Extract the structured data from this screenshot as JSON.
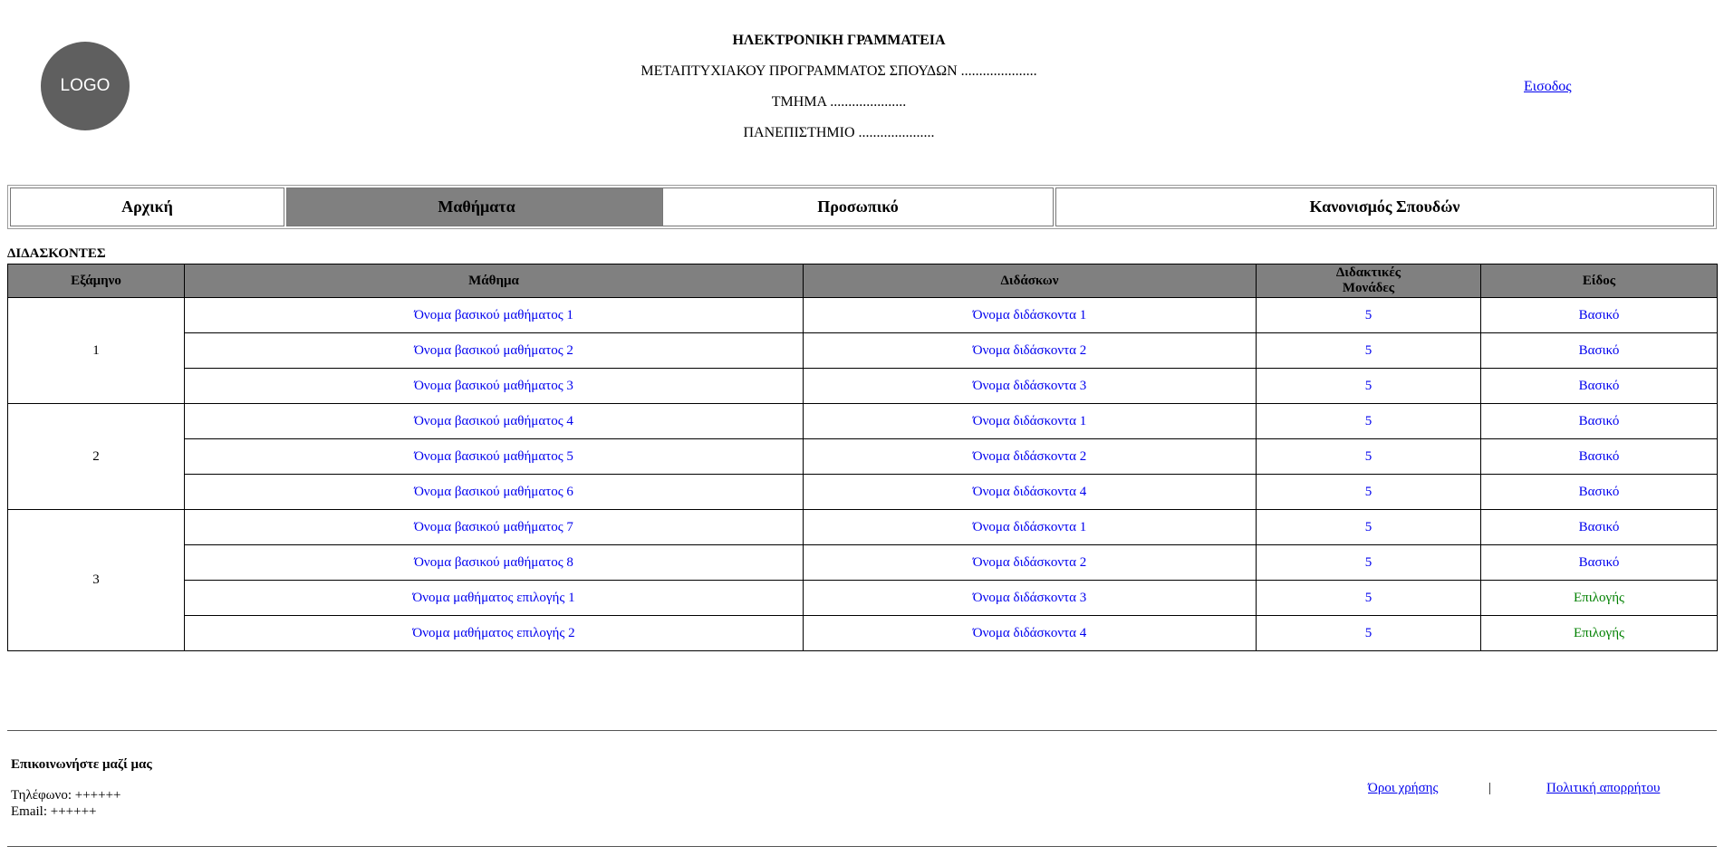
{
  "header": {
    "logo_text": "LOGO",
    "title": "ΗΛΕΚΤΡΟΝΙΚΗ ΓΡΑΜΜΑΤΕΙΑ",
    "program": "ΜΕΤΑΠΤΥΧΙΑΚΟΥ ΠΡΟΓΡΑΜΜΑΤΟΣ ΣΠΟΥΔΩΝ .....................",
    "department": "ΤΜΗΜΑ .....................",
    "university": "ΠΑΝΕΠΙΣΤΗΜΙΟ .....................",
    "login": "Εισοδος"
  },
  "nav": {
    "tabs": [
      {
        "label": "Αρχική",
        "active": false
      },
      {
        "label": "Μαθήματα",
        "active": true
      },
      {
        "label": "Προσωπικό",
        "active": false
      },
      {
        "label": "Κανονισμός Σπουδών",
        "active": false
      }
    ]
  },
  "section_title": "ΔΙΔΑΣΚΟΝΤΕΣ",
  "table": {
    "headers": [
      "Εξάμηνο",
      "Μάθημα",
      "Διδάσκων",
      "Διδακτικές Μονάδες",
      "Είδος"
    ],
    "semesters": [
      {
        "label": "1",
        "rows": [
          {
            "course": "Όνομα βασικού μαθήματος 1",
            "teacher": "Όνομα διδάσκοντα 1",
            "units": "5",
            "type": "Βασικό",
            "elective": false
          },
          {
            "course": "Όνομα βασικού μαθήματος 2",
            "teacher": "Όνομα διδάσκοντα 2",
            "units": "5",
            "type": "Βασικό",
            "elective": false
          },
          {
            "course": "Όνομα βασικού μαθήματος 3",
            "teacher": "Όνομα διδάσκοντα 3",
            "units": "5",
            "type": "Βασικό",
            "elective": false
          }
        ]
      },
      {
        "label": "2",
        "rows": [
          {
            "course": "Όνομα βασικού μαθήματος 4",
            "teacher": "Όνομα διδάσκοντα 1",
            "units": "5",
            "type": "Βασικό",
            "elective": false
          },
          {
            "course": "Όνομα βασικού μαθήματος 5",
            "teacher": "Όνομα διδάσκοντα 2",
            "units": "5",
            "type": "Βασικό",
            "elective": false
          },
          {
            "course": "Όνομα βασικού μαθήματος 6",
            "teacher": "Όνομα διδάσκοντα 4",
            "units": "5",
            "type": "Βασικό",
            "elective": false
          }
        ]
      },
      {
        "label": "3",
        "rows": [
          {
            "course": "Όνομα βασικού μαθήματος 7",
            "teacher": "Όνομα διδάσκοντα 1",
            "units": "5",
            "type": "Βασικό",
            "elective": false
          },
          {
            "course": "Όνομα βασικού μαθήματος 8",
            "teacher": "Όνομα διδάσκοντα 2",
            "units": "5",
            "type": "Βασικό",
            "elective": false
          },
          {
            "course": "Όνομα μαθήματος επιλογής 1",
            "teacher": "Όνομα διδάσκοντα 3",
            "units": "5",
            "type": "Επιλογής",
            "elective": true
          },
          {
            "course": "Όνομα μαθήματος επιλογής 2",
            "teacher": "Όνομα διδάσκοντα 4",
            "units": "5",
            "type": "Επιλογής",
            "elective": true
          }
        ]
      }
    ]
  },
  "footer": {
    "contact_title": "Επικοινωνήστε μαζί μας",
    "phone": "Τηλέφωνο: ++++++",
    "email": "Email: ++++++",
    "terms": "Όροι χρήσης",
    "separator": "|",
    "privacy": "Πολιτική απορρήτου"
  },
  "colors": {
    "link": "#0000ee",
    "elective": "#008000",
    "header_bg": "#808080",
    "active_tab_bg": "#808080",
    "logo_bg": "#5f5f5f"
  }
}
